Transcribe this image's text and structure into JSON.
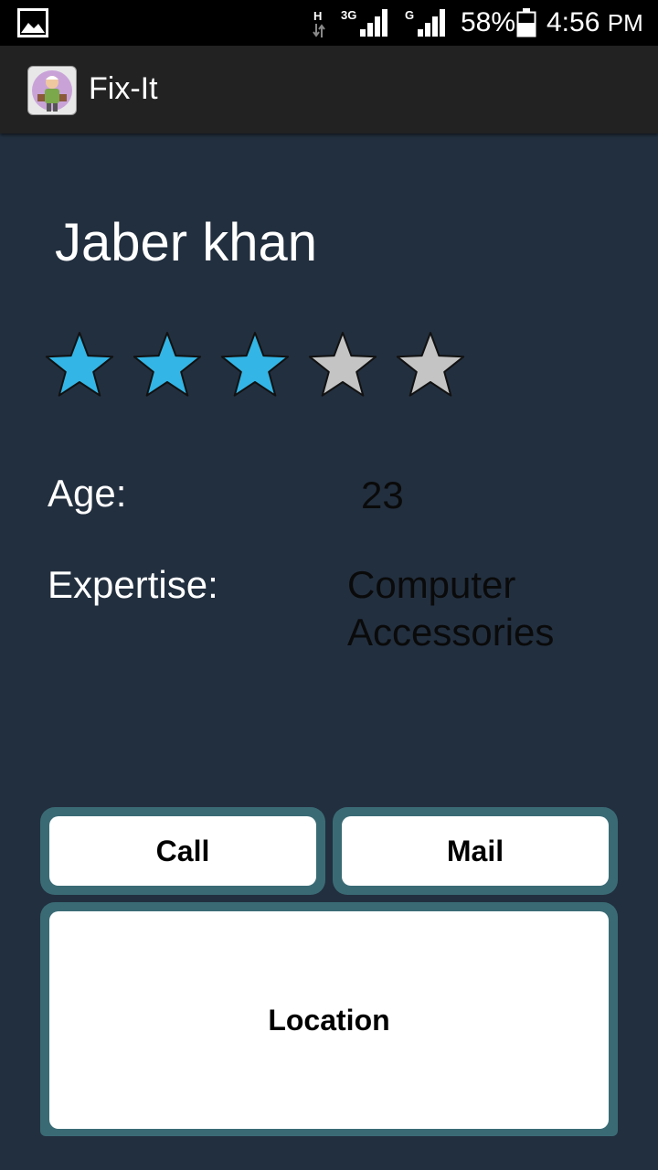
{
  "status_bar": {
    "network_type_1": "H",
    "network_type_2": "3G",
    "network_type_3": "G",
    "battery_percent": "58%",
    "time": "4:56",
    "ampm": "PM"
  },
  "app": {
    "title": "Fix-It",
    "icon": "fix-it-handyman-icon"
  },
  "profile": {
    "name": "Jaber khan",
    "rating": 3,
    "rating_max": 5,
    "colors": {
      "filled_star": "#33b5e5",
      "empty_star": "#c4c4c4"
    },
    "age_label": "Age:",
    "age_value": "23",
    "expertise_label": "Expertise:",
    "expertise_value_line1": "Computer",
    "expertise_value_line2": "Accessories"
  },
  "actions": {
    "call_label": "Call",
    "mail_label": "Mail",
    "location_label": "Location"
  }
}
